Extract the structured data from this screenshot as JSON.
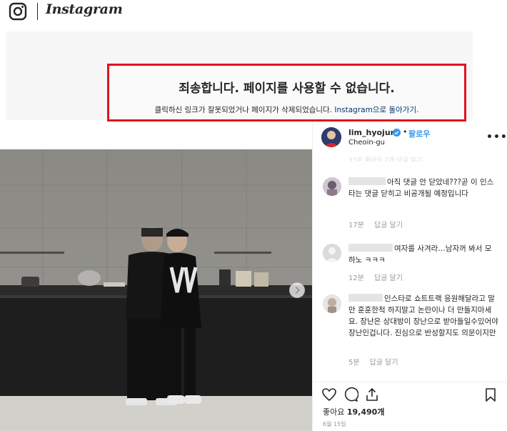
{
  "nav": {
    "wordmark": "Instagram"
  },
  "error": {
    "title": "죄송합니다. 페이지를 사용할 수 없습니다.",
    "desc_prefix": "클릭하신 링크가 잘못되었거나 페이지가 삭제되었습니다. ",
    "link_text": "Instagram으로 돌아가기.",
    "highlight_color": "#e0141e"
  },
  "post": {
    "username": "lim_hyojun",
    "dot": "•",
    "follow_label": "팔로우",
    "location": "Cheoin-gu",
    "faded_row": "33분   좋아요 2개   답글 달기",
    "comments": [
      {
        "text": "아직 댓글 안 닫았네???곧 이 인스타는 댓글 닫히고 비공개될 예정입니다",
        "time": "17분",
        "reply": "답글 달기"
      },
      {
        "text": "여자를 사겨라…남자꺼 봐서 모하노 ㅋㅋㅋ",
        "time": "12분",
        "reply": "답글 달기"
      },
      {
        "text": "인스타로 쇼트트랙 응원해달라고 말만 훈훈한척 하지말고 논란이나 더 만들지마세요. 장난은 상대방이 장난으로 받아들일수있어야 장난인겁니다. 진심으로 반성할지도 의문이지만",
        "time": "5분",
        "reply": "답글 달기"
      }
    ],
    "likes_prefix": "좋아요 ",
    "likes_count": "19,490개",
    "date": "6월 15일"
  },
  "icons": {
    "logo": "instagram-camera-icon",
    "verified": "verified-badge-icon",
    "more": "more-options-icon",
    "like": "heart-icon",
    "comment": "comment-bubble-icon",
    "share": "share-icon",
    "save": "bookmark-icon",
    "next": "chevron-right-icon"
  },
  "colors": {
    "link": "#003569",
    "follow": "#3897f0",
    "muted": "#999999"
  }
}
